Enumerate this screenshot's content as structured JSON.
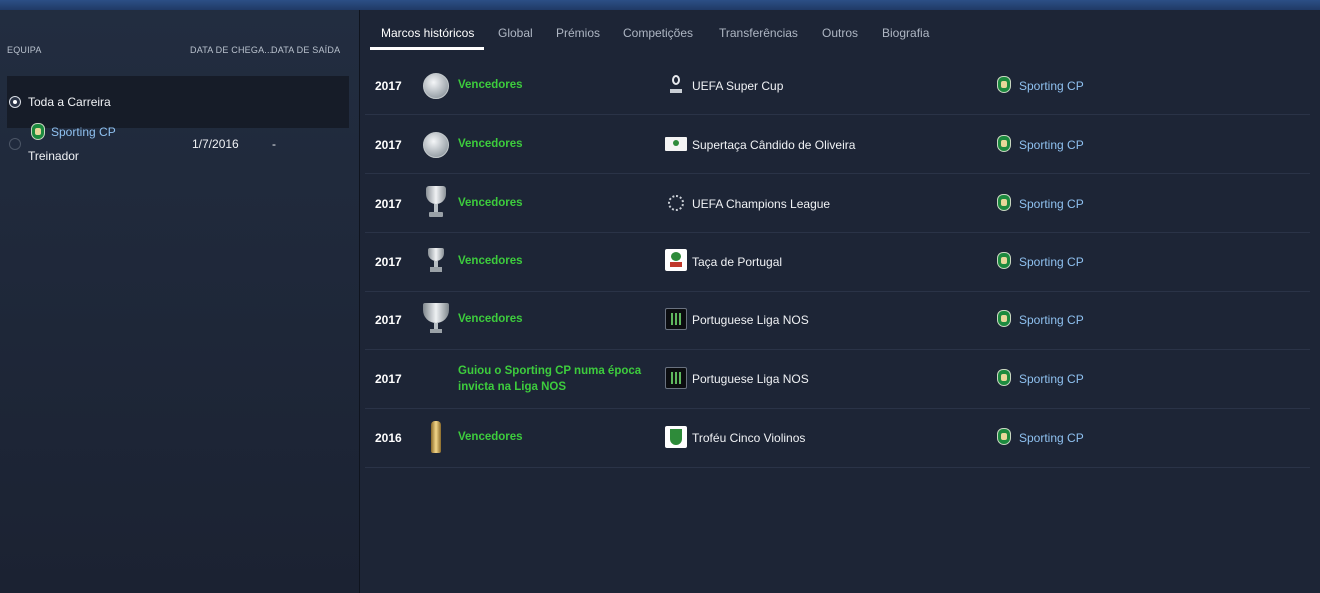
{
  "left_panel": {
    "headers": {
      "team": "EQUIPA",
      "arrival": "DATA DE CHEGA...",
      "departure": "DATA DE SAÍDA"
    },
    "career": {
      "label": "Toda a Carreira",
      "selected": true
    },
    "stints": [
      {
        "club": "Sporting CP",
        "role": "Treinador",
        "arrival": "1/7/2016",
        "departure": "-",
        "selected": false
      }
    ]
  },
  "tabs": [
    {
      "label": "Marcos históricos",
      "active": true
    },
    {
      "label": "Global",
      "active": false
    },
    {
      "label": "Prémios",
      "active": false
    },
    {
      "label": "Competições",
      "active": false
    },
    {
      "label": "Transferências",
      "active": false
    },
    {
      "label": "Outros",
      "active": false
    },
    {
      "label": "Biografia",
      "active": false
    }
  ],
  "milestones": [
    {
      "year": "2017",
      "trophy_icon": "plate-icon",
      "description": "Vencedores",
      "competition": "UEFA Super Cup",
      "competition_logo": "uefa-super-cup-logo",
      "club": "Sporting CP"
    },
    {
      "year": "2017",
      "trophy_icon": "plate-icon",
      "description": "Vencedores",
      "competition": "Supertaça Cândido de Oliveira",
      "competition_logo": "supertaca-logo",
      "club": "Sporting CP"
    },
    {
      "year": "2017",
      "trophy_icon": "big-cup-icon",
      "description": "Vencedores",
      "competition": "UEFA Champions League",
      "competition_logo": "champions-league-logo",
      "club": "Sporting CP"
    },
    {
      "year": "2017",
      "trophy_icon": "small-cup-icon",
      "description": "Vencedores",
      "competition": "Taça de Portugal",
      "competition_logo": "taca-de-portugal-logo",
      "club": "Sporting CP"
    },
    {
      "year": "2017",
      "trophy_icon": "league-cup-icon",
      "description": "Vencedores",
      "competition": "Portuguese Liga NOS",
      "competition_logo": "liga-nos-logo",
      "club": "Sporting CP"
    },
    {
      "year": "2017",
      "trophy_icon": "",
      "description": "Guiou o Sporting CP numa época invicta na Liga NOS",
      "competition": "Portuguese Liga NOS",
      "competition_logo": "liga-nos-logo",
      "club": "Sporting CP"
    },
    {
      "year": "2016",
      "trophy_icon": "gold-trophy-icon",
      "description": "Vencedores",
      "competition": "Troféu Cinco Violinos",
      "competition_logo": "cinco-violinos-logo",
      "club": "Sporting CP"
    }
  ],
  "colors": {
    "background": "#1d2536",
    "accent_link": "#8fc1f0",
    "winner_green": "#3dcc3d",
    "top_bar": "#2c4f86"
  }
}
